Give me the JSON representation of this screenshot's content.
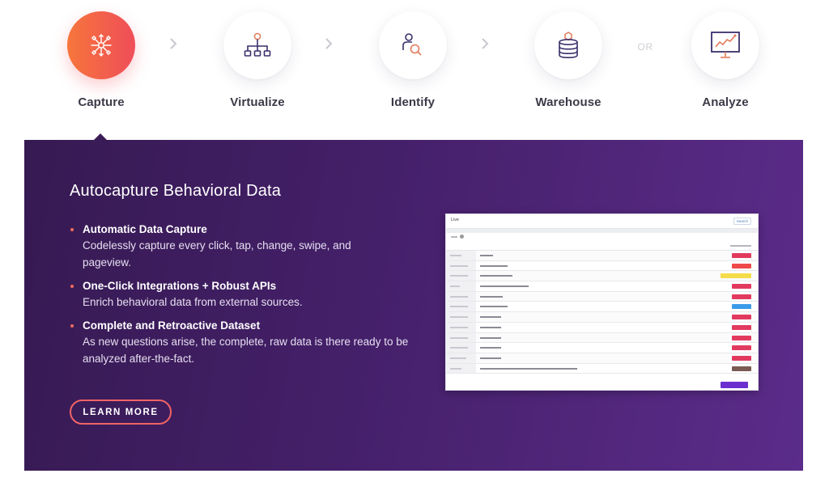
{
  "steps": [
    {
      "label": "Capture",
      "icon": "capture-hub-icon",
      "active": true
    },
    {
      "label": "Virtualize",
      "icon": "hierarchy-icon",
      "active": false
    },
    {
      "label": "Identify",
      "icon": "user-search-icon",
      "active": false
    },
    {
      "label": "Warehouse",
      "icon": "database-icon",
      "active": false
    },
    {
      "label": "Analyze",
      "icon": "presentation-chart-icon",
      "active": false
    }
  ],
  "separators": [
    ">",
    ">",
    ">",
    "OR"
  ],
  "panel": {
    "title": "Autocapture Behavioral Data",
    "features": [
      {
        "title": "Automatic Data Capture",
        "description": "Codelessly capture every click, tap, change, swipe, and pageview."
      },
      {
        "title": "One-Click Integrations + Robust APIs",
        "description": "Enrich behavioral data from external sources."
      },
      {
        "title": "Complete and Retroactive Dataset",
        "description": "As new questions arise, the complete, raw data is there ready to be analyzed after-the-fact."
      }
    ],
    "cta_label": "LEARN MORE"
  },
  "embedded_screenshot": {
    "header_title": "Live",
    "header_button": "Search",
    "row_badge_colors": [
      "#e23a5e",
      "#ef4a4a",
      "#f4dc4a",
      "#e23a5e",
      "#e23a5e",
      "#3a9be8",
      "#e23a5e",
      "#e23a5e",
      "#e23a5e",
      "#e23a5e",
      "#e23a5e",
      "#7a5a52",
      "#6b2fd0"
    ]
  },
  "colors": {
    "accent_orange": "#f6763c",
    "accent_pink": "#ef4d58",
    "panel_dark": "#361a52",
    "panel_light": "#5b2c8a",
    "icon_navy": "#3b2f6b",
    "icon_orange": "#e27a5a"
  }
}
